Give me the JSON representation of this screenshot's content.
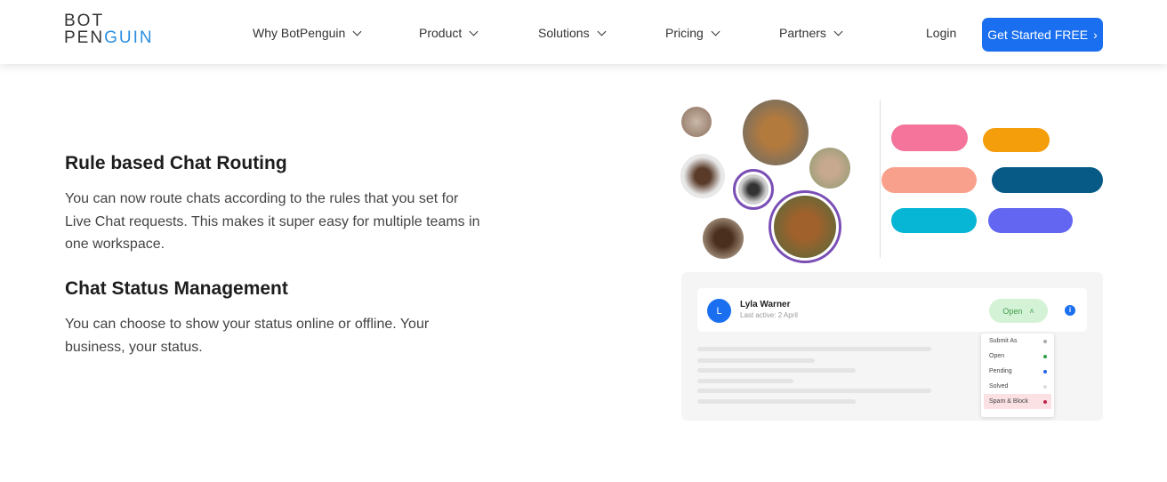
{
  "header": {
    "logo_top": "BOT",
    "logo_bottom_a": "PEN",
    "logo_bottom_b": "GUIN",
    "nav": [
      "Why BotPenguin",
      "Product",
      "Solutions",
      "Pricing",
      "Partners"
    ],
    "login": "Login",
    "cta": "Get Started FREE"
  },
  "features": [
    {
      "title": "Rule based Chat Routing",
      "text": "You can now route chats according to the rules that you set for Live Chat requests. This makes it super easy for multiple teams in one workspace."
    },
    {
      "title": "Chat Status Management",
      "text": "You can choose to show your status online or offline. Your business, your status."
    }
  ],
  "illustration": {
    "pill_colors": [
      "#f4749c",
      "#f59e0b",
      "#f9a08c",
      "#065a85",
      "#06b6d4",
      "#6366f1"
    ],
    "contact": {
      "initial": "L",
      "name": "Lyla Warner",
      "last_active": "Last active: 2 April",
      "status": "Open"
    },
    "status_menu": [
      {
        "label": "Submit As",
        "color": "#aaaaaa"
      },
      {
        "label": "Open",
        "color": "#2e9e44"
      },
      {
        "label": "Pending",
        "color": "#2563eb"
      },
      {
        "label": "Solved",
        "color": "#dddddd"
      },
      {
        "label": "Spam & Block",
        "color": "#c0264a"
      }
    ]
  }
}
